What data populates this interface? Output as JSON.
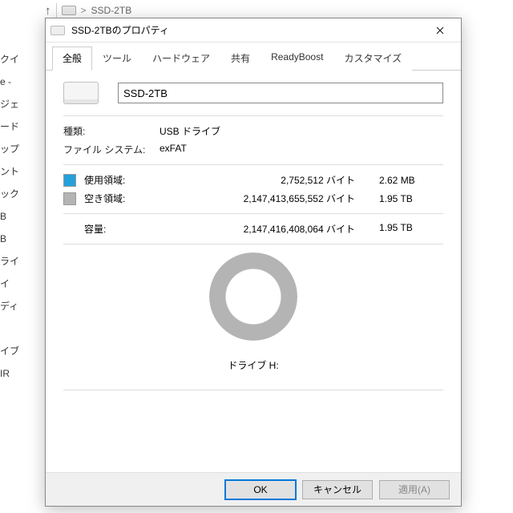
{
  "explorer": {
    "breadcrumb_sep": ">",
    "breadcrumb_item": "SSD-2TB",
    "side_items": [
      "クイ",
      "",
      "e -",
      "",
      "ジェ",
      "ード",
      "ップ",
      "ント",
      "",
      "",
      "ック",
      "",
      "B",
      "B",
      "ライ",
      "イ",
      "ディ",
      "",
      "",
      "",
      "",
      "イブ",
      "IR"
    ],
    "side_selected_index": 17
  },
  "dialog": {
    "title": "SSD-2TBのプロパティ",
    "tabs": [
      "全般",
      "ツール",
      "ハードウェア",
      "共有",
      "ReadyBoost",
      "カスタマイズ"
    ],
    "active_tab": 0,
    "drive_name": "SSD-2TB",
    "type_label": "種類:",
    "type_value": "USB ドライブ",
    "fs_label": "ファイル システム:",
    "fs_value": "exFAT",
    "used_label": "使用領域:",
    "used_bytes": "2,752,512 バイト",
    "used_human": "2.62 MB",
    "free_label": "空き領域:",
    "free_bytes": "2,147,413,655,552 バイト",
    "free_human": "1.95 TB",
    "capacity_label": "容量:",
    "capacity_bytes": "2,147,416,408,064 バイト",
    "capacity_human": "1.95 TB",
    "drive_letter_label": "ドライブ H:",
    "buttons": {
      "ok": "OK",
      "cancel": "キャンセル",
      "apply": "適用(A)"
    },
    "colors": {
      "used": "#26a0da",
      "free": "#b4b4b4"
    }
  }
}
